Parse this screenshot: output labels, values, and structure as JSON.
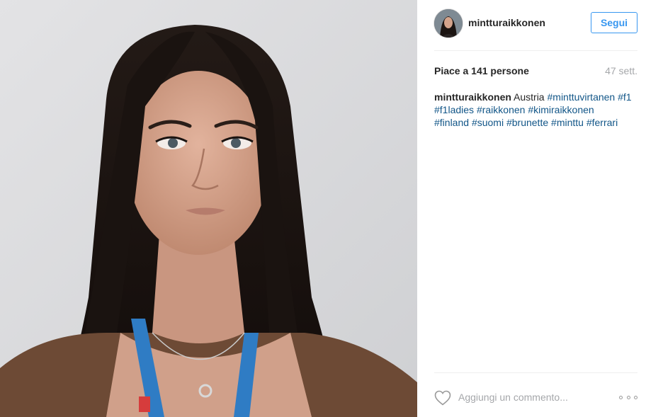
{
  "post": {
    "image": {
      "alt": "",
      "background_color": "#d9d9db",
      "hair_color": "#1c1512",
      "skin_color": "#d4a48c",
      "top_color": "#6d4a35",
      "lanyard_color": "#2f7cc4"
    },
    "author": {
      "username": "mintturaikkonen",
      "avatar_icon": "user-avatar"
    },
    "follow_label": "Segui",
    "likes_prefix": "Piace a ",
    "likes_count": "141",
    "likes_suffix": " persone",
    "age": "47 sett.",
    "caption": {
      "username": "mintturaikkonen",
      "text": " Austria ",
      "hashtags": [
        "#minttuvirtanen",
        "#f1",
        "#f1ladies",
        "#raikkonen",
        "#kimiraikkonen",
        "#finland",
        "#suomi",
        "#brunette",
        "#minttu",
        "#ferrari"
      ]
    },
    "comment_placeholder": "Aggiungi un commento...",
    "like_icon": "heart-icon",
    "more_icon": "more-options-icon",
    "accent_color": "#3897f0",
    "hashtag_color": "#125688"
  }
}
